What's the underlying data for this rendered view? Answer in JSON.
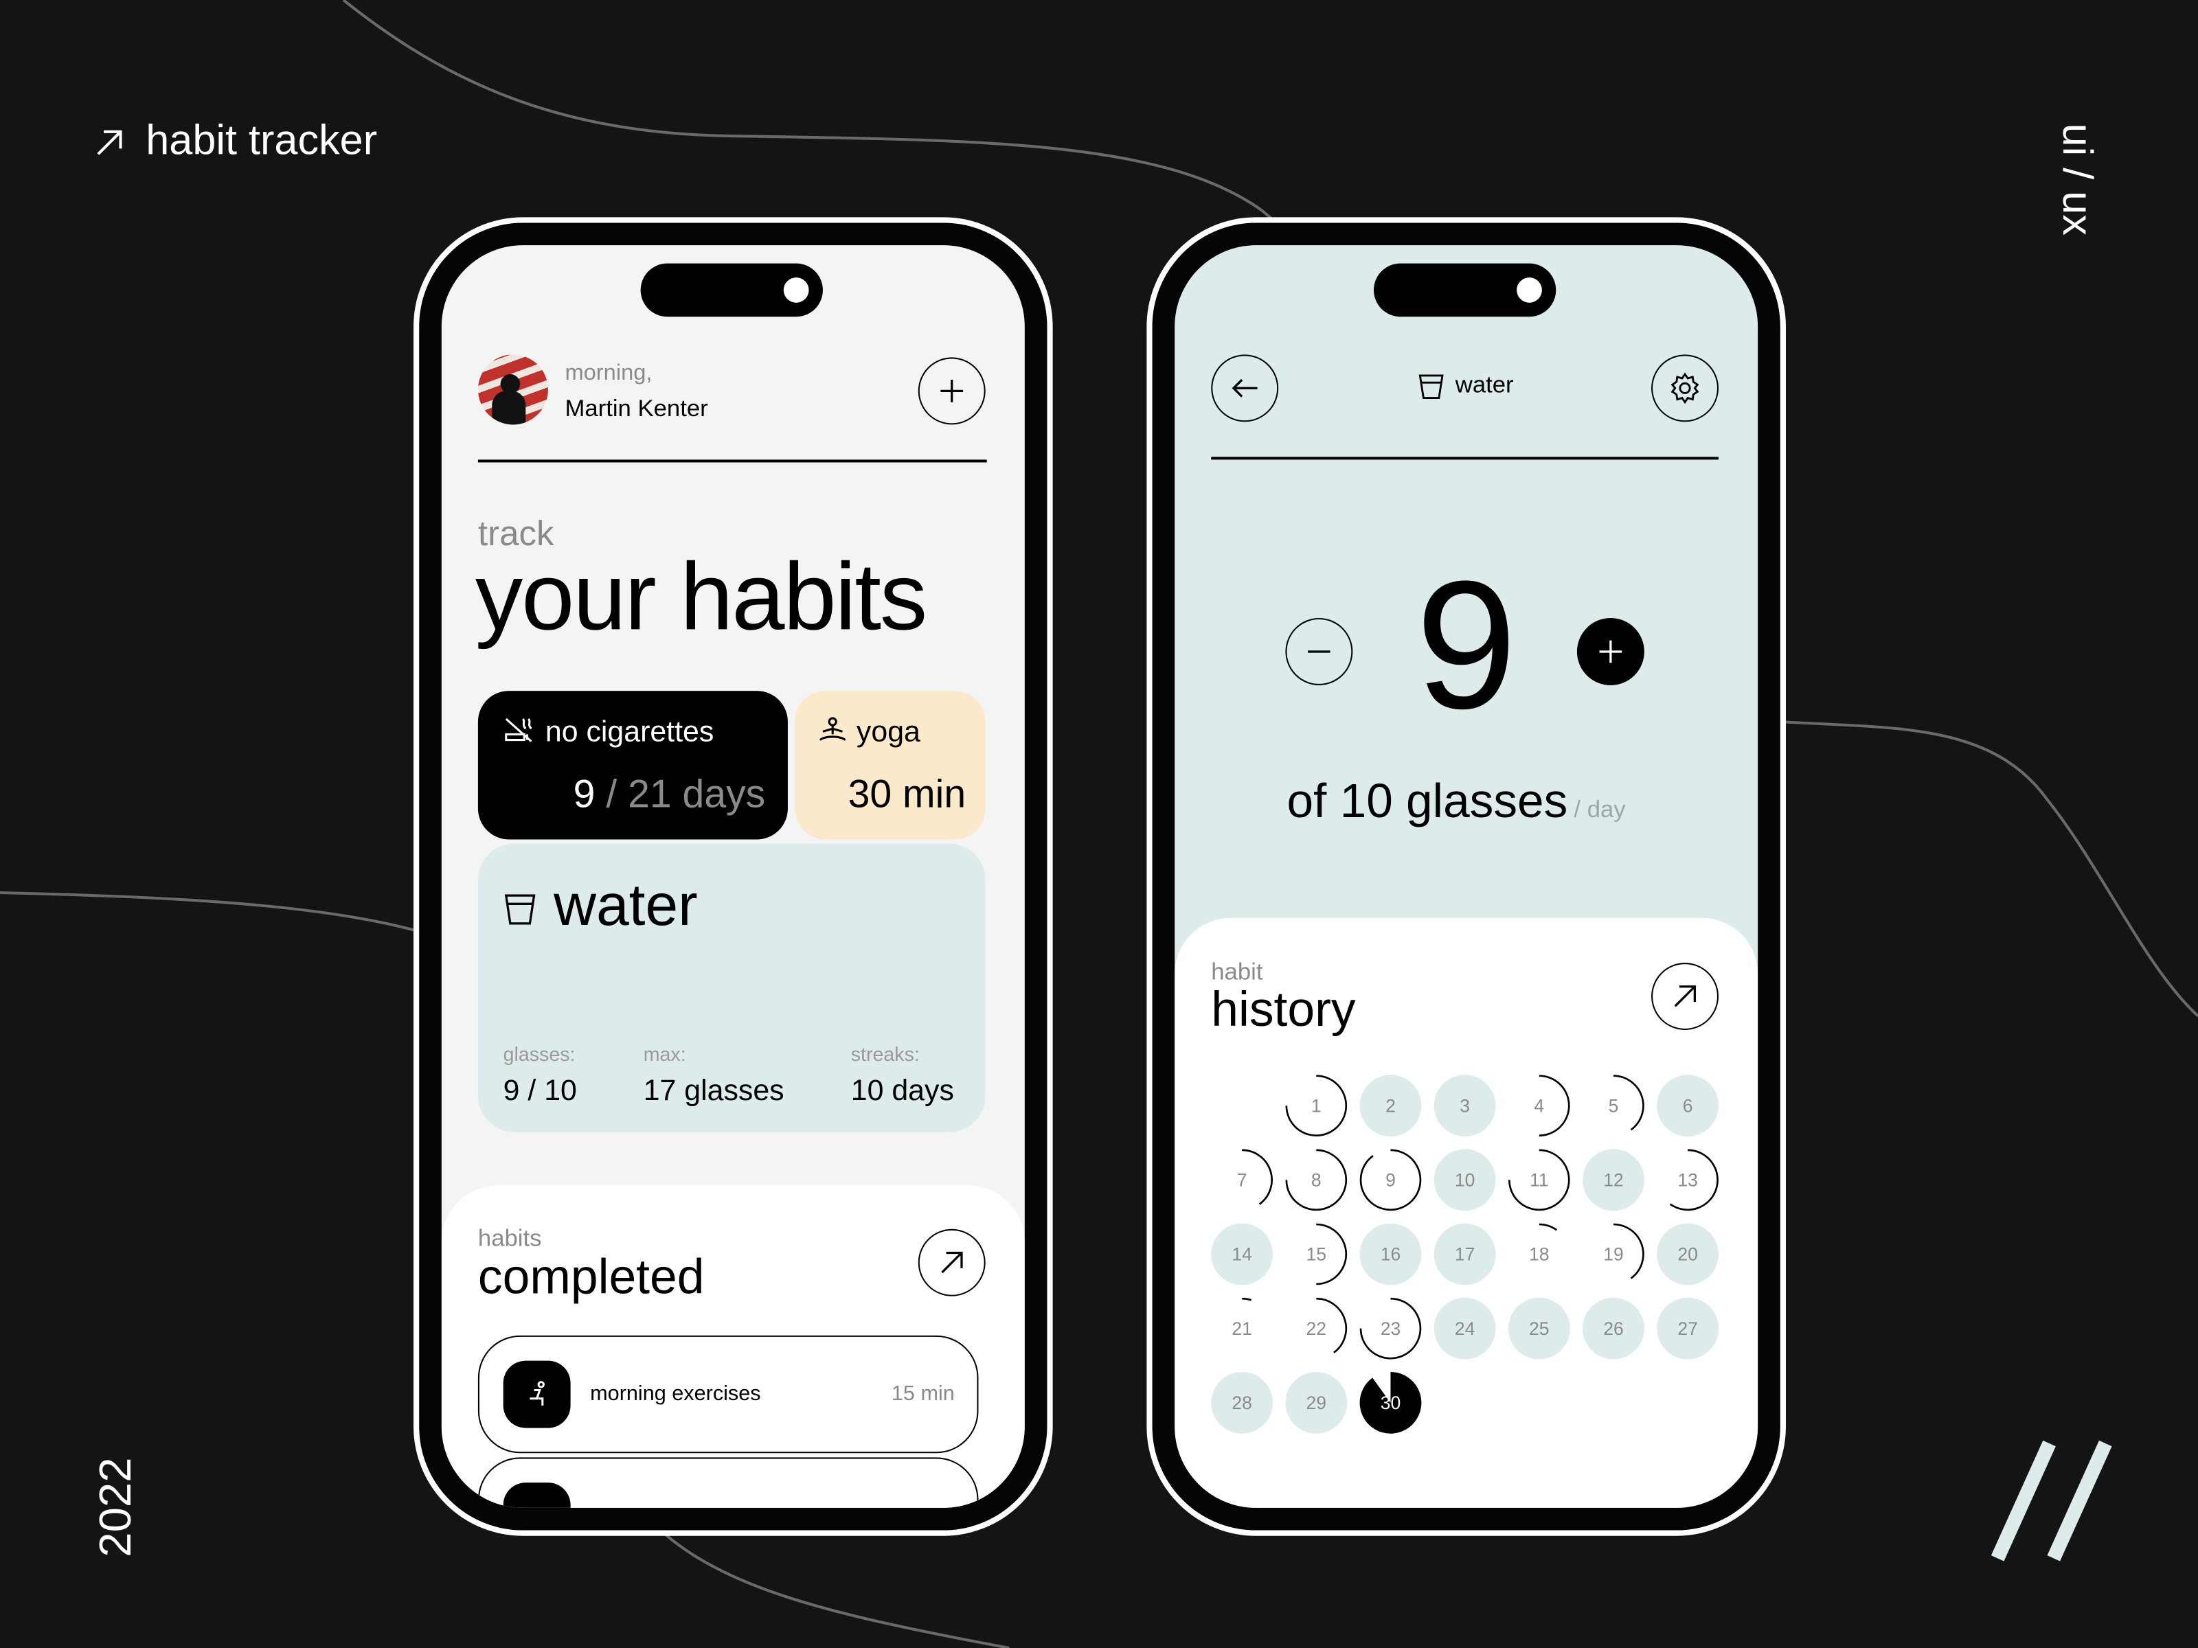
{
  "brand": {
    "title": "habit tracker",
    "side_label": "ui / ux",
    "year": "2022"
  },
  "colors": {
    "background": "#141414",
    "mint": "#ddecea",
    "cream": "#fbe9cc",
    "black": "#000000"
  },
  "home": {
    "greeting": "morning,",
    "user_name": "Martin Kenter",
    "heading_small": "track",
    "heading_large": "your habits",
    "cards": {
      "cigarettes": {
        "title": "no cigarettes",
        "value": "9",
        "total": "/ 21 days",
        "icon": "no-smoking-icon"
      },
      "yoga": {
        "title": "yoga",
        "value": "30 min",
        "icon": "meditation-icon"
      },
      "water": {
        "title": "water",
        "icon": "cup-icon",
        "stats": [
          {
            "label": "glasses:",
            "value": "9 / 10"
          },
          {
            "label": "max:",
            "value": "17 glasses"
          },
          {
            "label": "streaks:",
            "value": "10 days"
          }
        ]
      }
    },
    "completed": {
      "small": "habits",
      "large": "completed",
      "items": [
        {
          "name": "morning exercises",
          "duration": "15 min",
          "icon": "exercise-icon"
        }
      ]
    }
  },
  "detail": {
    "title": "water",
    "count": "9",
    "goal_text": "of 10 glasses",
    "goal_unit": "/ day",
    "history": {
      "small": "habit",
      "large": "history",
      "start_column": 1,
      "days": [
        {
          "day": "1",
          "progress": 0.75
        },
        {
          "day": "2",
          "progress": 1
        },
        {
          "day": "3",
          "progress": 1
        },
        {
          "day": "4",
          "progress": 0.5
        },
        {
          "day": "5",
          "progress": 0.4
        },
        {
          "day": "6",
          "progress": 1
        },
        {
          "day": "7",
          "progress": 0.4
        },
        {
          "day": "8",
          "progress": 0.75
        },
        {
          "day": "9",
          "progress": 0.9
        },
        {
          "day": "10",
          "progress": 1
        },
        {
          "day": "11",
          "progress": 0.75
        },
        {
          "day": "12",
          "progress": 1
        },
        {
          "day": "13",
          "progress": 0.6
        },
        {
          "day": "14",
          "progress": 1
        },
        {
          "day": "15",
          "progress": 0.5
        },
        {
          "day": "16",
          "progress": 1
        },
        {
          "day": "17",
          "progress": 1
        },
        {
          "day": "18",
          "progress": 0.1
        },
        {
          "day": "19",
          "progress": 0.4
        },
        {
          "day": "20",
          "progress": 1
        },
        {
          "day": "21",
          "progress": 0.05
        },
        {
          "day": "22",
          "progress": 0.4
        },
        {
          "day": "23",
          "progress": 0.75
        },
        {
          "day": "24",
          "progress": 1
        },
        {
          "day": "25",
          "progress": 1
        },
        {
          "day": "26",
          "progress": 1
        },
        {
          "day": "27",
          "progress": 1
        },
        {
          "day": "28",
          "progress": 1
        },
        {
          "day": "29",
          "progress": 1
        },
        {
          "day": "30",
          "progress": 0.9,
          "today": true
        }
      ]
    }
  }
}
